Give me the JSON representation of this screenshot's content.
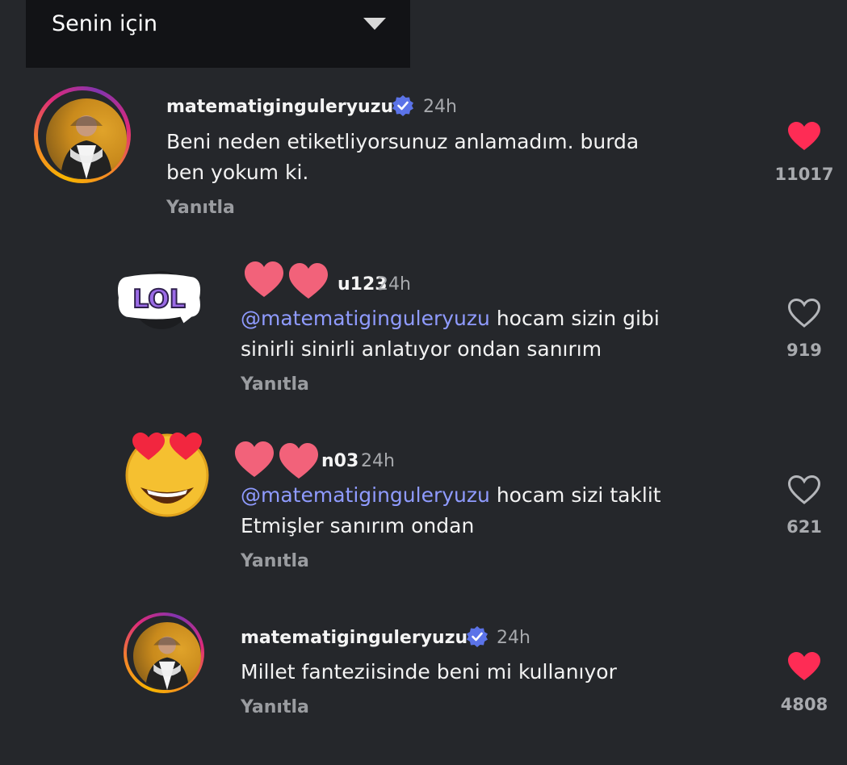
{
  "sort": {
    "label": "Senin için"
  },
  "comments": [
    {
      "username": "matematiginguleryuzu",
      "time": "24h",
      "mention": "",
      "lines": [
        "Beni neden etiketliyorsunuz anlamadım. burda",
        "ben yokum ki."
      ],
      "reply": "Yanıtla",
      "likes": "11017",
      "liked": true
    },
    {
      "username_visible": "u123",
      "time": "24h",
      "mention": "@matematiginguleryuzu",
      "line1_rest": " hocam sizin gibi",
      "line2": "sinirli sinirli anlatıyor ondan sanırım",
      "reply": "Yanıtla",
      "likes": "919",
      "liked": false,
      "sticker": "LOL"
    },
    {
      "username_visible": "n03",
      "time": "24h",
      "mention": "@matematiginguleryuzu",
      "line1_rest": " hocam sizi taklit",
      "line2": "Etmişler sanırım ondan",
      "reply": "Yanıtla",
      "likes": "621",
      "liked": false
    },
    {
      "username": "matematiginguleryuzu",
      "time": "24h",
      "lines": [
        "Millet fanteziisinde beni mi kullanıyor"
      ],
      "reply": "Yanıtla",
      "likes": "4808",
      "liked": true
    }
  ],
  "colors": {
    "background": "#25272b",
    "mention": "#8f9bff",
    "like_red": "#fe2c55",
    "verified": "#5b73e8"
  }
}
